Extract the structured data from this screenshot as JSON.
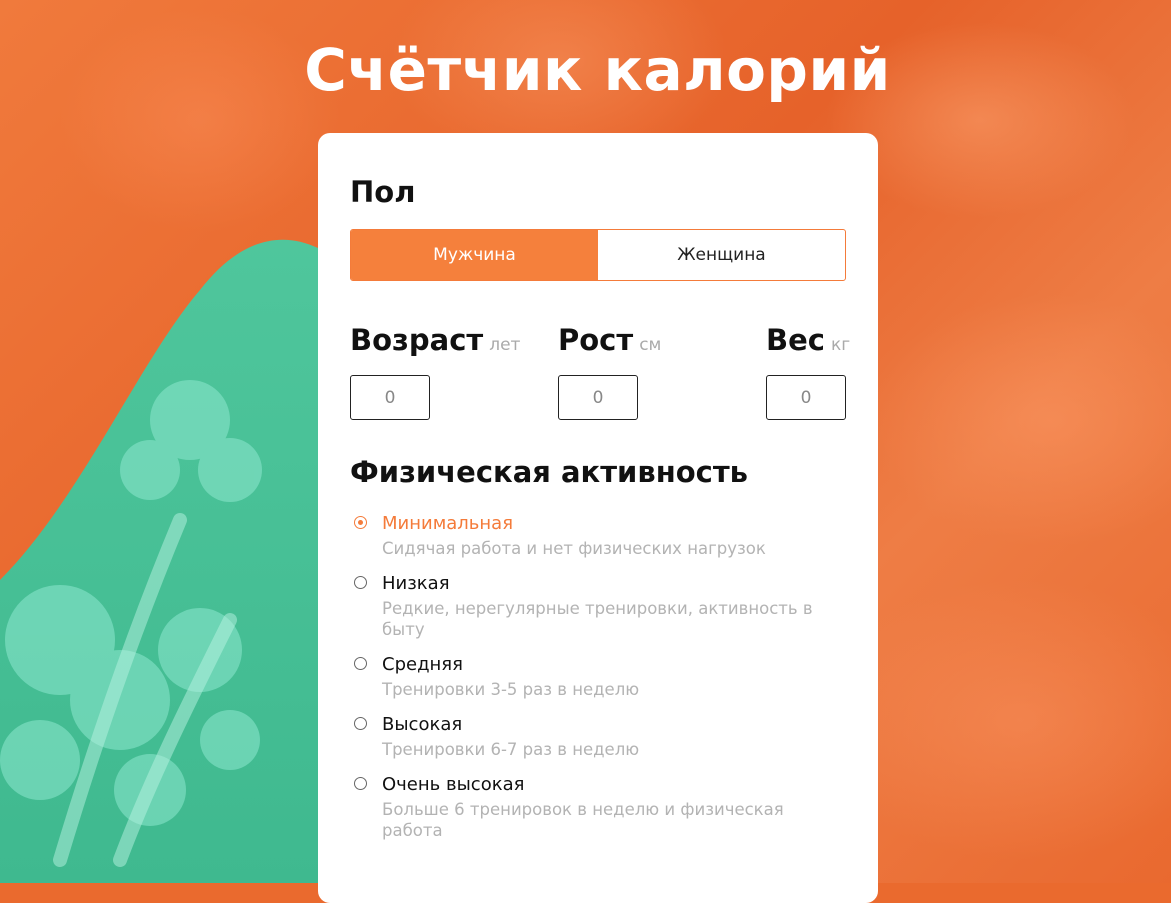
{
  "page": {
    "title": "Счётчик калорий"
  },
  "colors": {
    "accent": "#f5803c",
    "background": "#ea6a2e",
    "decor_green": "#55c9a0"
  },
  "gender": {
    "heading": "Пол",
    "options": [
      {
        "label": "Мужчина",
        "selected": true
      },
      {
        "label": "Женщина",
        "selected": false
      }
    ]
  },
  "params": {
    "age": {
      "label": "Возраст",
      "unit": "лет",
      "value": "0"
    },
    "height": {
      "label": "Рост",
      "unit": "см",
      "value": "0"
    },
    "weight": {
      "label": "Вес",
      "unit": "кг",
      "value": "0"
    }
  },
  "activity": {
    "heading": "Физическая активность",
    "options": [
      {
        "name": "Минимальная",
        "desc": "Сидячая работа и нет физических нагрузок",
        "selected": true
      },
      {
        "name": "Низкая",
        "desc": "Редкие, нерегулярные тренировки, активность в быту",
        "selected": false
      },
      {
        "name": "Средняя",
        "desc": "Тренировки 3-5 раз в неделю",
        "selected": false
      },
      {
        "name": "Высокая",
        "desc": "Тренировки 6-7 раз в неделю",
        "selected": false
      },
      {
        "name": "Очень высокая",
        "desc": "Больше 6 тренировок в неделю и физическая работа",
        "selected": false
      }
    ]
  }
}
